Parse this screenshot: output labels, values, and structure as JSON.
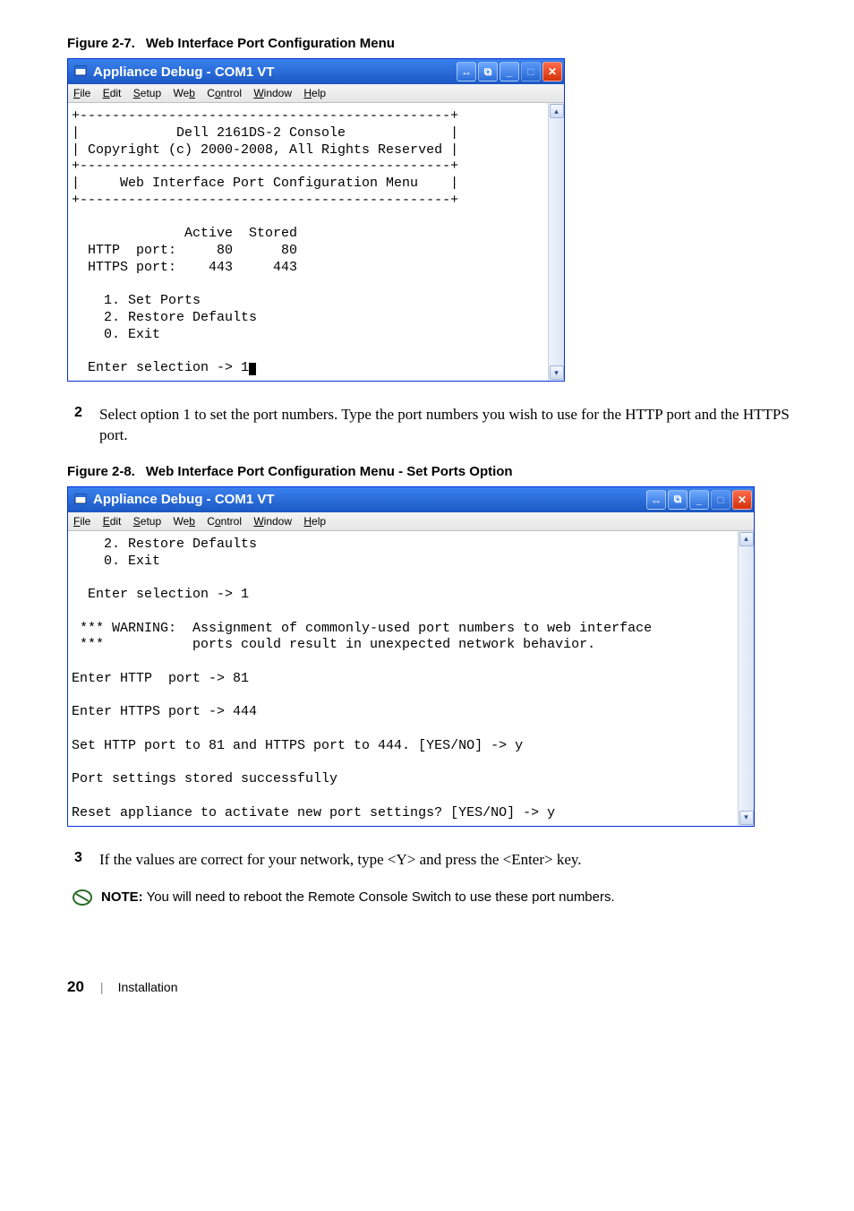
{
  "figure1": {
    "caption_num": "Figure 2-7.",
    "caption_text": "Web Interface Port Configuration Menu",
    "window_title": "Appliance Debug - COM1 VT",
    "menubar": [
      "File",
      "Edit",
      "Setup",
      "Web",
      "Control",
      "Window",
      "Help"
    ],
    "menubar_underlines": [
      "F",
      "E",
      "S",
      "b",
      "o",
      "W",
      "H"
    ],
    "terminal": "+----------------------------------------------+\n|            Dell 2161DS-2 Console             |\n| Copyright (c) 2000-2008, All Rights Reserved |\n+----------------------------------------------+\n|     Web Interface Port Configuration Menu    |\n+----------------------------------------------+\n\n              Active  Stored\n  HTTP  port:     80      80\n  HTTPS port:    443     443\n\n    1. Set Ports\n    2. Restore Defaults\n    0. Exit\n\n  Enter selection -> 1"
  },
  "step2": {
    "num": "2",
    "text": "Select option 1 to set the port numbers. Type the port numbers you wish to use for the HTTP port and the HTTPS port."
  },
  "figure2": {
    "caption_num": "Figure 2-8.",
    "caption_text": "Web Interface Port Configuration Menu - Set Ports Option",
    "window_title": "Appliance Debug - COM1 VT",
    "menubar": [
      "File",
      "Edit",
      "Setup",
      "Web",
      "Control",
      "Window",
      "Help"
    ],
    "menubar_underlines": [
      "F",
      "E",
      "S",
      "b",
      "o",
      "W",
      "H"
    ],
    "terminal": "    2. Restore Defaults\n    0. Exit\n\n  Enter selection -> 1\n\n *** WARNING:  Assignment of commonly-used port numbers to web interface\n ***           ports could result in unexpected network behavior.\n\nEnter HTTP  port -> 81\n\nEnter HTTPS port -> 444\n\nSet HTTP port to 81 and HTTPS port to 444. [YES/NO] -> y\n\nPort settings stored successfully\n\nReset appliance to activate new port settings? [YES/NO] -> y"
  },
  "step3": {
    "num": "3",
    "text": "If the values are correct for your network, type <Y> and press the <Enter> key."
  },
  "note": {
    "label": "NOTE:",
    "text": "You will need to reboot the Remote Console Switch to use these port numbers."
  },
  "footer": {
    "page": "20",
    "section": "Installation"
  },
  "window_buttons": {
    "extra1": "↔",
    "extra2": "⧉",
    "minimize": "_",
    "maximize": "□",
    "close": "✕"
  },
  "scroll": {
    "up": "▴",
    "down": "▾"
  }
}
